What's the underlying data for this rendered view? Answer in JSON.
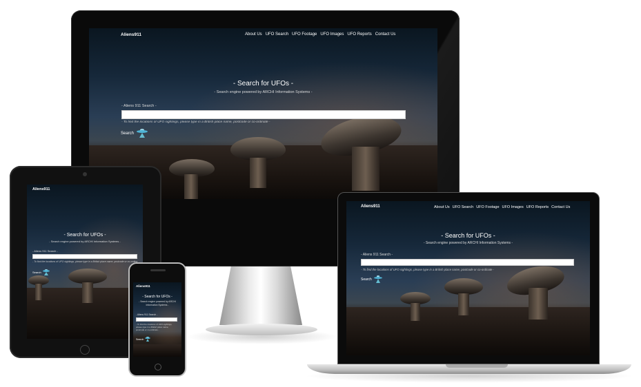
{
  "site": {
    "logo": "Aliens911",
    "nav": [
      "About Us",
      "UFO Search",
      "UFO Footage",
      "UFO Images",
      "UFO Reports",
      "Contact Us"
    ],
    "title": "- Search for UFOs -",
    "subtitle": "- Search engine powered by ARCHI Information Systems -",
    "search_label": "- Aliens 911 Search -",
    "search_value": "",
    "hint": "- To find the locations of UFO sightings, please type in a British place name, postcode or co-ordinate -",
    "search_button": "Search",
    "search_icon": "ufo-icon"
  },
  "devices": [
    "desktop-monitor",
    "tablet",
    "laptop",
    "phone"
  ],
  "colors": {
    "accent": "#4fb3d4",
    "text": "#ffffff",
    "sky_dark": "#0a1620"
  }
}
